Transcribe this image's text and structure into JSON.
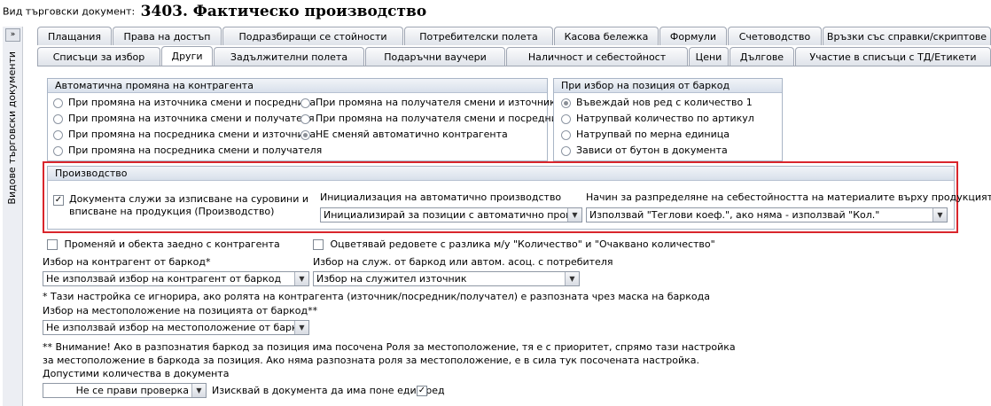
{
  "header": {
    "label": "Вид търговски документ:",
    "title": "3403. Фактическо производство"
  },
  "sidebar": {
    "collapse_glyph": "»",
    "vertical_title": "Видове търговски документи"
  },
  "tabs_row1": [
    "Плащания",
    "Права на достъп",
    "Подразбиращи се стойности",
    "Потребителски полета",
    "Касова бележка",
    "Формули",
    "Счетоводство",
    "Връзки със справки/скриптове"
  ],
  "tabs_row2": [
    "Списъци за избор",
    "Други",
    "Задължителни полета",
    "Подаръчни ваучери",
    "Наличност и себестойност",
    "Цени",
    "Дългове",
    "Участие в списъци с ТД/Етикети"
  ],
  "active_tab": "Други",
  "auto_change": {
    "title": "Автоматична промяна на контрагента",
    "options": [
      {
        "label": "При промяна на източника смени и посредника",
        "selected": false
      },
      {
        "label": "При промяна на източника смени и получателя",
        "selected": false
      },
      {
        "label": "При промяна на посредника смени и източника",
        "selected": false
      },
      {
        "label": "При промяна на посредника смени и получателя",
        "selected": false
      },
      {
        "label": "При промяна на получателя смени и източника",
        "selected": false
      },
      {
        "label": "При промяна на получателя смени и посредника",
        "selected": false
      },
      {
        "label": "НЕ сменяй автоматично контрагента",
        "selected": true
      }
    ]
  },
  "barcode_pos": {
    "title": "При избор на позиция от баркод",
    "options": [
      {
        "label": "Въвеждай нов ред с количество 1",
        "selected": true
      },
      {
        "label": "Натрупвай количество по артикул",
        "selected": false
      },
      {
        "label": "Натрупвай по мерна единица",
        "selected": false
      },
      {
        "label": "Зависи от бутон в документа",
        "selected": false
      }
    ]
  },
  "production": {
    "title": "Производство",
    "checkbox_label_1": "Документа служи за изписване на суровини и",
    "checkbox_label_2": "вписване на продукция (Производство)",
    "checkbox_checked": true,
    "init_label": "Инициализация на автоматично производство",
    "init_value": "Инициализирай за позиции с автоматично производст",
    "cost_label": "Начин за разпределяне на себестойността на материалите върху продукцията",
    "cost_value": "Използвай \"Теглови коеф.\", ако няма - използвай \"Кол.\""
  },
  "misc": {
    "change_object_label": "Променяй и обекта заедно с контрагента",
    "colorize_label": "Оцветявай редовете с разлика м/у \"Количество\" и \"Очаквано количество\"",
    "barcode_contractor_label": "Избор на контрагент от баркод*",
    "barcode_contractor_value": "Не използвай избор на контрагент от баркод",
    "employee_label": "Избор на служ. от баркод или автом. асоц. с потребителя",
    "employee_value": "Избор на служител източник",
    "note_ignore": "* Тази настройка се игнорира, ако ролята на контрагента (източник/посредник/получател) е разпозната чрез маска на баркода",
    "location_label": "Избор на местоположение на позицията от баркод**",
    "location_value": "Не използвай избор на местоположение от баркод",
    "warning_1": "** Внимание! Ако в разпознатия баркод за позиция има посочена Роля за местоположение, тя е с приоритет, спрямо тази настройка",
    "warning_2": "за местоположение в баркода за позиция. Ако няма разпозната роля за местоположение, е в сила тук посочената настройка.",
    "qty_label": "Допустими количества в документа",
    "qty_value": "Не се прави проверка",
    "require_row_label": "Изисквай в документа да има поне един ред",
    "require_row_checked": true
  }
}
